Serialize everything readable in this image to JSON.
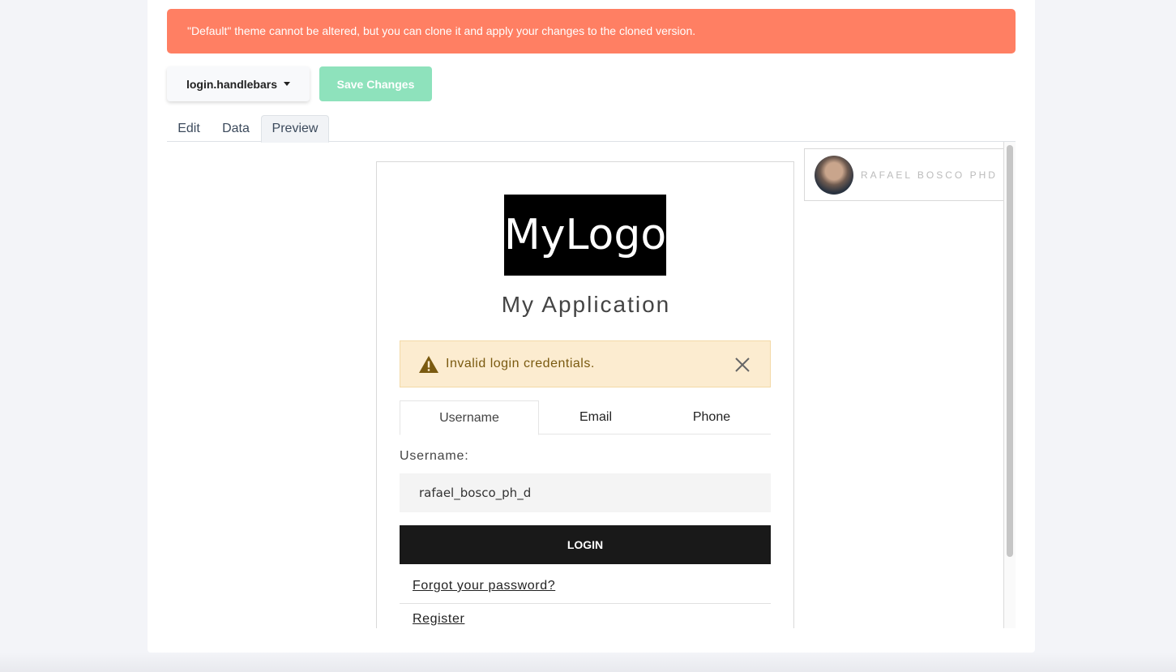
{
  "banner": {
    "message": "\"Default\" theme cannot be altered, but you can clone it and apply your changes to the cloned version."
  },
  "toolbar": {
    "template_select": "login.handlebars",
    "save_label": "Save Changes"
  },
  "tabs": [
    {
      "label": "Edit"
    },
    {
      "label": "Data"
    },
    {
      "label": "Preview"
    }
  ],
  "preview": {
    "logo_text": "MyLogo",
    "app_title": "My Application",
    "alert": "Invalid login credentials.",
    "login_tabs": [
      {
        "label": "Username"
      },
      {
        "label": "Email"
      },
      {
        "label": "Phone"
      }
    ],
    "username_label": "Username:",
    "username_value": "rafael_bosco_ph_d",
    "login_button": "LOGIN",
    "forgot_link": "Forgot your password?",
    "register_link": "Register",
    "user": {
      "name": "RAFAEL BOSCO PHD"
    }
  },
  "colors": {
    "banner_bg": "#ff7f63",
    "save_bg": "#8ee2bc",
    "alert_bg": "#fcecd0",
    "login_bg": "#191919"
  }
}
